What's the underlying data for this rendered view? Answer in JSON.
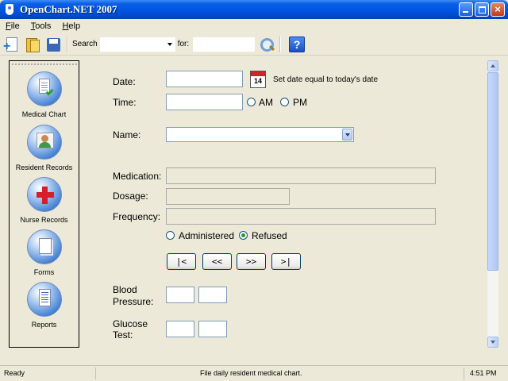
{
  "window": {
    "title": "OpenChart.NET 2007"
  },
  "menu": [
    "File",
    "Tools",
    "Help"
  ],
  "toolbar": {
    "search_label": "Search",
    "search_field_value": "",
    "for_label": "for:",
    "for_value": "",
    "help_glyph": "?"
  },
  "sidebar": {
    "items": [
      {
        "label": "Medical Chart",
        "icon": "medical-chart-icon"
      },
      {
        "label": "Resident Records",
        "icon": "resident-records-icon"
      },
      {
        "label": "Nurse Records",
        "icon": "nurse-records-icon"
      },
      {
        "label": "Forms",
        "icon": "forms-icon"
      },
      {
        "label": "Reports",
        "icon": "reports-icon"
      }
    ]
  },
  "form": {
    "date_label": "Date:",
    "date_value": "",
    "calendar_day": "14",
    "set_today_text": "Set date equal to today's date",
    "time_label": "Time:",
    "time_value": "",
    "am_label": "AM",
    "pm_label": "PM",
    "name_label": "Name:",
    "name_value": "",
    "medication_label": "Medication:",
    "dosage_label": "Dosage:",
    "frequency_label": "Frequency:",
    "administered_label": "Administered",
    "refused_label": "Refused",
    "refused_checked": true,
    "nav": [
      "|<",
      "<<",
      ">>",
      ">|"
    ],
    "bp_label_line1": "Blood",
    "bp_label_line2": "Pressure:",
    "glucose_label_line1": "Glucose",
    "glucose_label_line2": "Test:"
  },
  "status": {
    "left": "Ready",
    "middle": "File daily resident medical chart.",
    "right": "4:51 PM"
  }
}
